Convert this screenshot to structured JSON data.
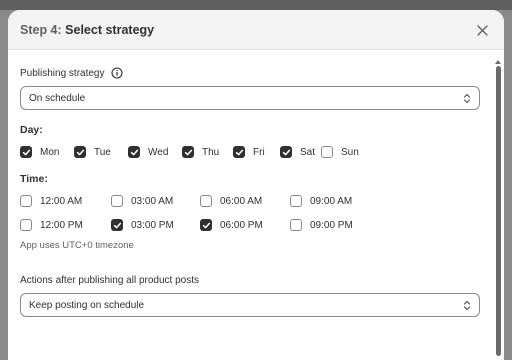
{
  "modal": {
    "step_label": "Step 4:",
    "title": "Select strategy"
  },
  "publishing_strategy": {
    "label": "Publishing strategy",
    "value": "On schedule"
  },
  "day": {
    "title": "Day:",
    "options": [
      {
        "label": "Mon",
        "checked": true
      },
      {
        "label": "Tue",
        "checked": true
      },
      {
        "label": "Wed",
        "checked": true
      },
      {
        "label": "Thu",
        "checked": true
      },
      {
        "label": "Fri",
        "checked": true
      },
      {
        "label": "Sat",
        "checked": true
      },
      {
        "label": "Sun",
        "checked": false
      }
    ]
  },
  "time": {
    "title": "Time:",
    "options": [
      {
        "label": "12:00 AM",
        "checked": false
      },
      {
        "label": "03:00 AM",
        "checked": false
      },
      {
        "label": "06:00 AM",
        "checked": false
      },
      {
        "label": "09:00 AM",
        "checked": false
      },
      {
        "label": "12:00 PM",
        "checked": false
      },
      {
        "label": "03:00 PM",
        "checked": true
      },
      {
        "label": "06:00 PM",
        "checked": true
      },
      {
        "label": "09:00 PM",
        "checked": false
      }
    ],
    "note": "App uses UTC+0 timezone"
  },
  "actions_after": {
    "label": "Actions after publishing all product posts",
    "value": "Keep posting on schedule"
  }
}
